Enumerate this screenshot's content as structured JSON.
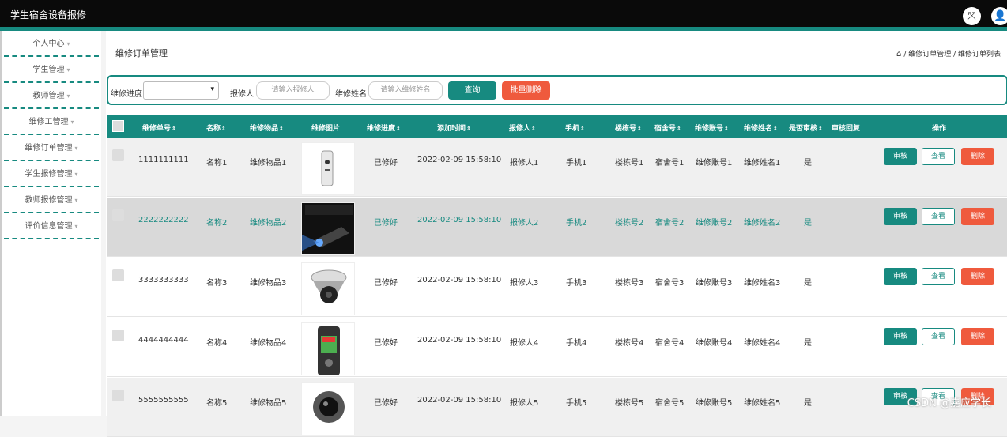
{
  "app": {
    "title": "学生宿舍设备报修"
  },
  "sidebar": {
    "items": [
      {
        "label": "个人中心"
      },
      {
        "label": "学生管理"
      },
      {
        "label": "教师管理"
      },
      {
        "label": "维修工管理"
      },
      {
        "label": "维修订单管理"
      },
      {
        "label": "学生报修管理"
      },
      {
        "label": "教师报修管理"
      },
      {
        "label": "评价信息管理"
      }
    ]
  },
  "page": {
    "title": "维修订单管理",
    "breadcrumb": "/ 维修订单管理 / 维修订单列表"
  },
  "search": {
    "progress_label": "维修进度",
    "progress_value": "",
    "reporter_label": "报修人",
    "reporter_placeholder": "请输入报修人",
    "repairer_label": "维修姓名",
    "repairer_placeholder": "请输入维修姓名",
    "query_button": "查询",
    "batch_delete_button": "批量删除"
  },
  "colors": {
    "accent": "#178a80",
    "danger": "#ef5a3d",
    "topbar": "#0a0a0a"
  },
  "table": {
    "columns": [
      "维修单号",
      "名称",
      "维修物品",
      "维修图片",
      "维修进度",
      "添加时间",
      "报修人",
      "手机",
      "楼栋号",
      "宿舍号",
      "维修账号",
      "维修姓名",
      "是否审核",
      "审核回复",
      "操作"
    ],
    "actions": {
      "audit": "审核",
      "view": "查看",
      "delete": "删除"
    },
    "rows": [
      {
        "order_no": "1111111111",
        "name": "名称1",
        "item": "维修物品1",
        "image": "remote",
        "progress": "已修好",
        "time": "2022-02-09 15:58:10",
        "reporter": "报修人1",
        "phone": "手机1",
        "building": "楼栋号1",
        "dorm": "宿舍号1",
        "account": "维修账号1",
        "repairer": "维修姓名1",
        "audited": "是",
        "reply": ""
      },
      {
        "order_no": "2222222222",
        "name": "名称2",
        "item": "维修物品2",
        "image": "projector",
        "progress": "已修好",
        "time": "2022-02-09 15:58:10",
        "reporter": "报修人2",
        "phone": "手机2",
        "building": "楼栋号2",
        "dorm": "宿舍号2",
        "account": "维修账号2",
        "repairer": "维修姓名2",
        "audited": "是",
        "reply": ""
      },
      {
        "order_no": "3333333333",
        "name": "名称3",
        "item": "维修物品3",
        "image": "dome-camera",
        "progress": "已修好",
        "time": "2022-02-09 15:58:10",
        "reporter": "报修人3",
        "phone": "手机3",
        "building": "楼栋号3",
        "dorm": "宿舍号3",
        "account": "维修账号3",
        "repairer": "维修姓名3",
        "audited": "是",
        "reply": ""
      },
      {
        "order_no": "4444444444",
        "name": "名称4",
        "item": "维修物品4",
        "image": "recorder",
        "progress": "已修好",
        "time": "2022-02-09 15:58:10",
        "reporter": "报修人4",
        "phone": "手机4",
        "building": "楼栋号4",
        "dorm": "宿舍号4",
        "account": "维修账号4",
        "repairer": "维修姓名4",
        "audited": "是",
        "reply": ""
      },
      {
        "order_no": "5555555555",
        "name": "名称5",
        "item": "维修物品5",
        "image": "camera",
        "progress": "已修好",
        "time": "2022-02-09 15:58:10",
        "reporter": "报修人5",
        "phone": "手机5",
        "building": "楼栋号5",
        "dorm": "宿舍号5",
        "account": "维修账号5",
        "repairer": "维修姓名5",
        "audited": "是",
        "reply": ""
      }
    ]
  },
  "watermark": "CSDN @嘉应学长"
}
